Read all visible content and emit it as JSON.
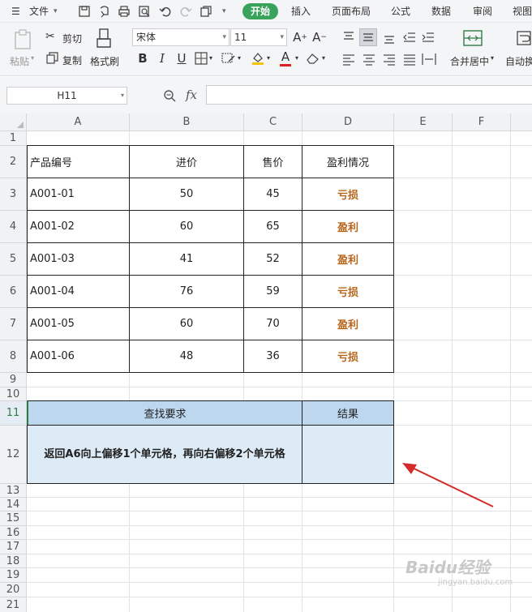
{
  "menubar": {
    "file": "文件",
    "tabs": [
      "开始",
      "插入",
      "页面布局",
      "公式",
      "数据",
      "审阅",
      "视图"
    ]
  },
  "ribbon": {
    "paste": "粘贴",
    "cut": "剪切",
    "copy": "复制",
    "format_painter": "格式刷",
    "font_name": "宋体",
    "font_size": "11",
    "merge_center": "合并居中",
    "auto_wrap": "自动换"
  },
  "formula_bar": {
    "name_box": "H11",
    "fx": "fx",
    "formula": ""
  },
  "columns": [
    "A",
    "B",
    "C",
    "D",
    "E",
    "F"
  ],
  "rows": [
    "1",
    "2",
    "3",
    "4",
    "5",
    "6",
    "7",
    "8",
    "9",
    "10",
    "11",
    "12",
    "13",
    "14",
    "15",
    "16",
    "17",
    "18",
    "19",
    "20",
    "21"
  ],
  "table": {
    "headers": [
      "产品编号",
      "进价",
      "售价",
      "盈利情况"
    ],
    "rows": [
      [
        "A001-01",
        "50",
        "45",
        "亏损"
      ],
      [
        "A001-02",
        "60",
        "65",
        "盈利"
      ],
      [
        "A001-03",
        "41",
        "52",
        "盈利"
      ],
      [
        "A001-04",
        "76",
        "59",
        "亏损"
      ],
      [
        "A001-05",
        "60",
        "70",
        "盈利"
      ],
      [
        "A001-06",
        "48",
        "36",
        "亏损"
      ]
    ]
  },
  "lookup": {
    "header_left": "查找要求",
    "header_right": "结果",
    "body_text": "返回A6向上偏移1个单元格，再向右偏移2个单元格",
    "result": ""
  },
  "colors": {
    "start_tab": "#3aa35b",
    "profit_text": "#b8651b",
    "lookup_header": "#bdd7ee",
    "lookup_body": "#ddebf7",
    "arrow": "#d42a2a"
  },
  "watermark": "Baidu经验 jingyan.baidu.com"
}
